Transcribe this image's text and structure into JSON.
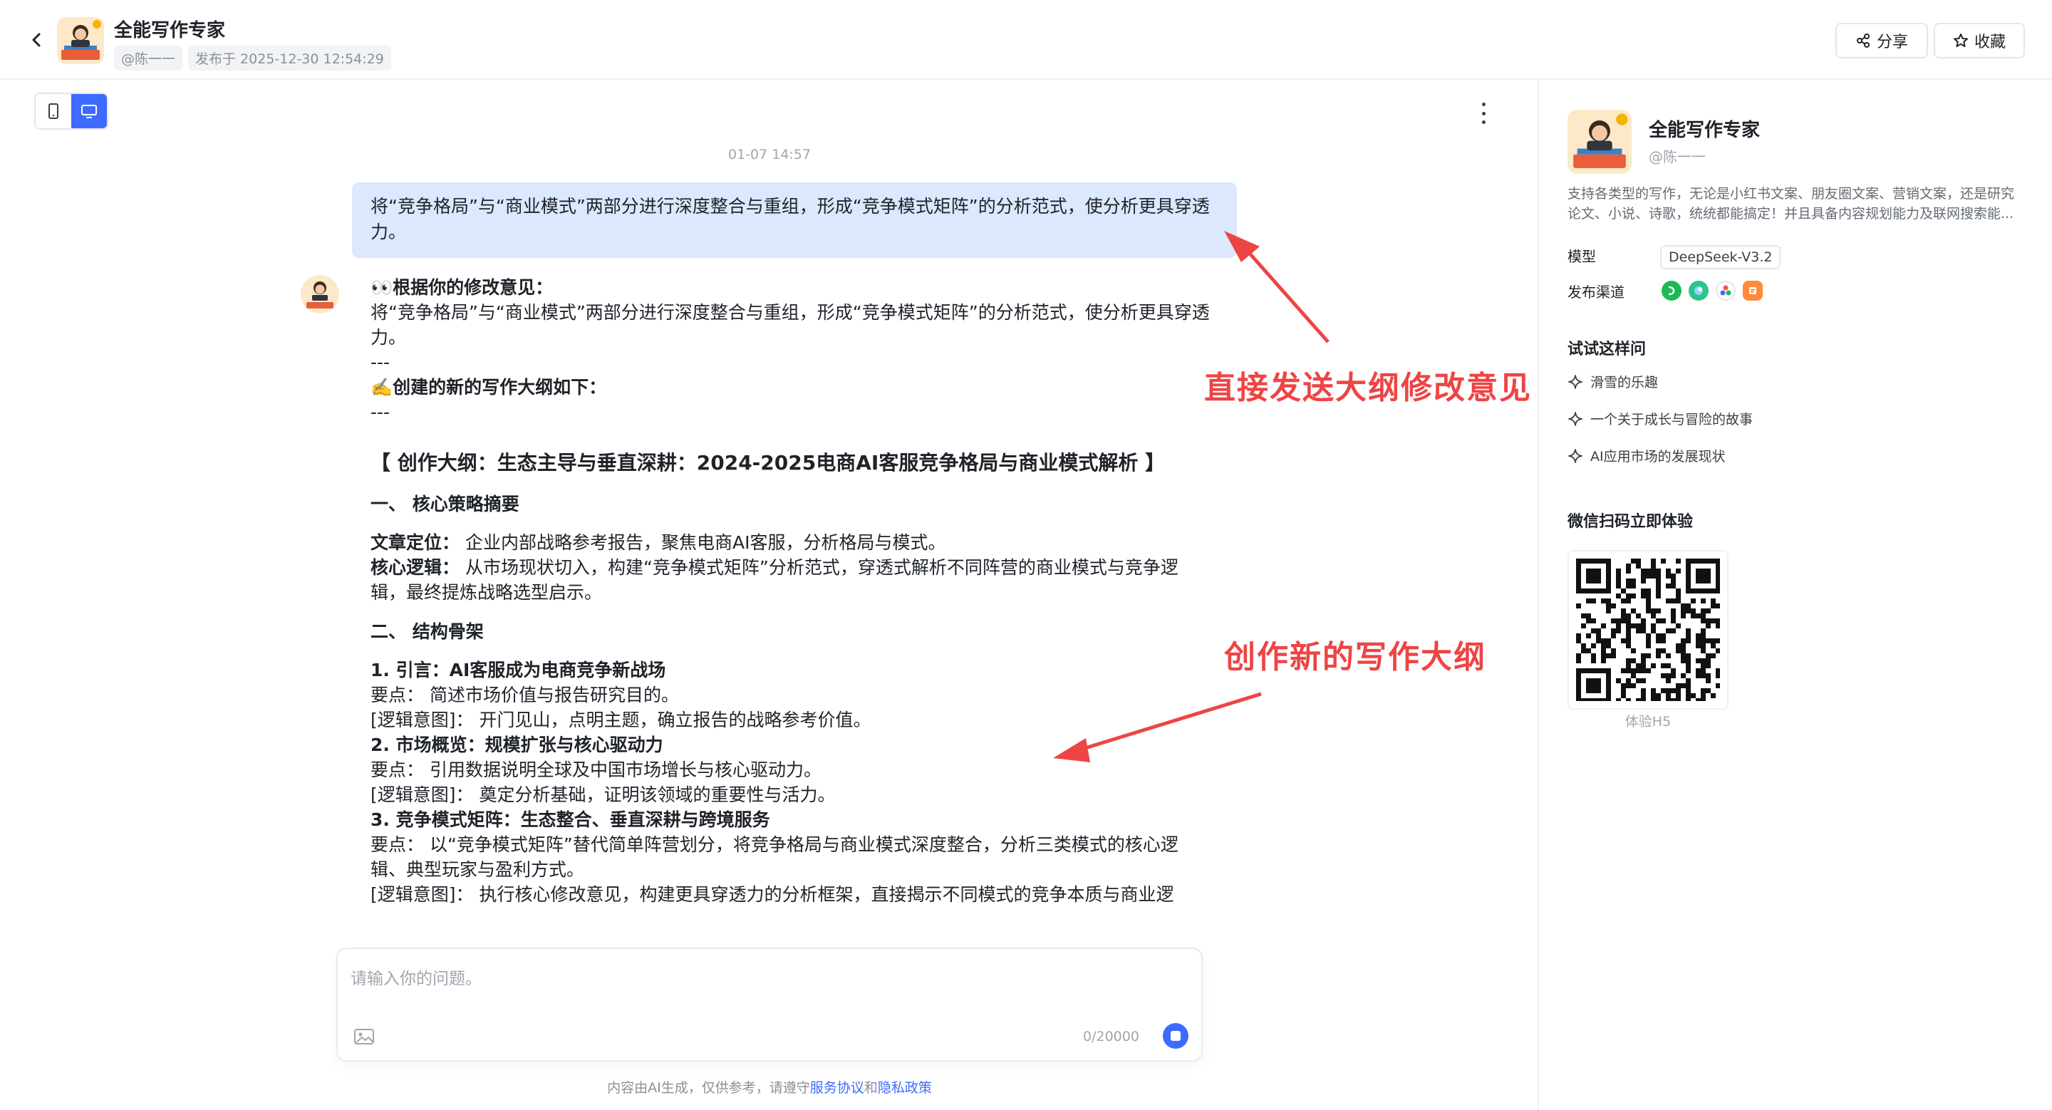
{
  "header": {
    "title": "全能写作专家",
    "author": "@陈一一",
    "published": "发布于 2025-12-30 12:54:29",
    "share_label": "分享",
    "favorite_label": "收藏"
  },
  "chat": {
    "timestamp": "01-07 14:57",
    "user_message": "将“竞争格局”与“商业模式”两部分进行深度整合与重组，形成“竞争模式矩阵”的分析范式，使分析更具穿透力。",
    "bot": {
      "intro_label": "👀根据你的修改意见：",
      "intro_text": "将“竞争格局”与“商业模式”两部分进行深度整合与重组，形成“竞争模式矩阵”的分析范式，使分析更具穿透力。",
      "divider1": "---",
      "new_outline_label": "✍️创建的新的写作大纲如下：",
      "divider2": "---",
      "outline_title": "【 创作大纲：生态主导与垂直深耕：2024-2025电商AI客服竞争格局与商业模式解析 】",
      "section1": "一、 核心策略摘要",
      "positioning_label": "文章定位：",
      "positioning_text": " 企业内部战略参考报告，聚焦电商AI客服，分析格局与模式。",
      "logic_label": "核心逻辑：",
      "logic_text": " 从市场现状切入，构建“竞争模式矩阵”分析范式，穿透式解析不同阵营的商业模式与竞争逻辑，最终提炼战略选型启示。",
      "section2": "二、 结构骨架",
      "items": [
        {
          "title": "1. 引言：AI客服成为电商竞争新战场",
          "point": "要点： 简述市场价值与报告研究目的。",
          "intent": "[逻辑意图]： 开门见山，点明主题，确立报告的战略参考价值。"
        },
        {
          "title": "2. 市场概览：规模扩张与核心驱动力",
          "point": "要点： 引用数据说明全球及中国市场增长与核心驱动力。",
          "intent": "[逻辑意图]： 奠定分析基础，证明该领域的重要性与活力。"
        },
        {
          "title": "3. 竞争模式矩阵：生态整合、垂直深耕与跨境服务",
          "point": "要点： 以“竞争模式矩阵”替代简单阵营划分，将竞争格局与商业模式深度整合，分析三类模式的核心逻辑、典型玩家与盈利方式。",
          "intent": "[逻辑意图]： 执行核心修改意见，构建更具穿透力的分析框架，直接揭示不同模式的竞争本质与商业逻"
        }
      ]
    }
  },
  "input": {
    "placeholder": "请输入你的问题。",
    "char_count": "0/20000"
  },
  "footer": {
    "prefix": "内容由AI生成，仅供参考，请遵守",
    "terms": "服务协议",
    "and": "和",
    "privacy": "隐私政策"
  },
  "sidebar": {
    "name": "全能写作专家",
    "author": "@陈一一",
    "description": "支持各类型的写作，无论是小红书文案、朋友圈文案、营销文案，还是研究论文、小说、诗歌，统统都能搞定！并且具备内容规划能力及联网搜索能...",
    "model_label": "模型",
    "model_value": "DeepSeek-V3.2",
    "channels_label": "发布渠道",
    "try_label": "试试这样问",
    "suggestions": [
      "滑雪的乐趣",
      "一个关于成长与冒险的故事",
      "AI应用市场的发展现状"
    ],
    "wechat_label": "微信扫码立即体验",
    "qr_caption": "体验H5"
  },
  "annotations": {
    "top": "直接发送大纲修改意见",
    "bottom": "创作新的写作大纲",
    "color": "#ef4444"
  },
  "colors": {
    "accent": "#3d6bff",
    "user_bubble": "#dbe8fd"
  }
}
